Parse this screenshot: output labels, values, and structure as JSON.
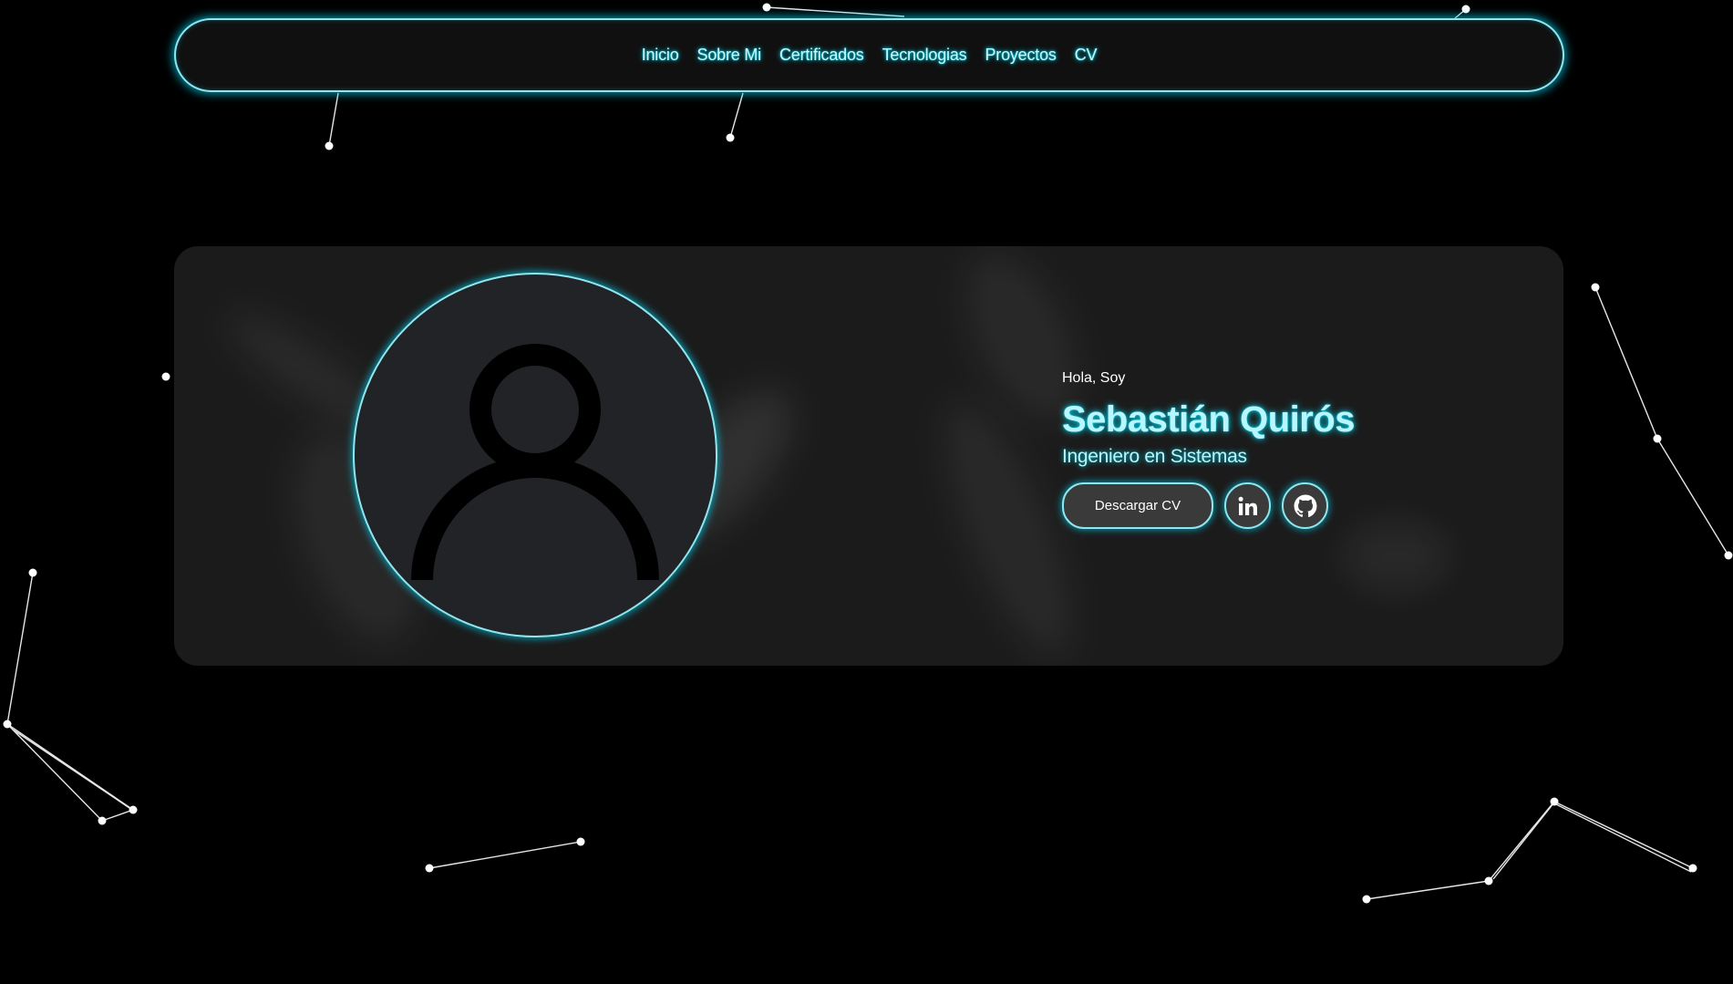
{
  "nav": {
    "items": [
      {
        "label": "Inicio"
      },
      {
        "label": "Sobre Mi"
      },
      {
        "label": "Certificados"
      },
      {
        "label": "Tecnologias"
      },
      {
        "label": "Proyectos"
      },
      {
        "label": "CV"
      }
    ]
  },
  "hero": {
    "greeting": "Hola, Soy",
    "name": "Sebastián Quirós",
    "role": "Ingeniero en Sistemas",
    "download_label": "Descargar CV",
    "avatar_icon": "user-icon",
    "social": [
      {
        "icon": "linkedin-icon"
      },
      {
        "icon": "github-icon"
      }
    ]
  },
  "theme": {
    "accent": "#00d8f0",
    "background": "#000000",
    "card": "#1b1b1b"
  }
}
